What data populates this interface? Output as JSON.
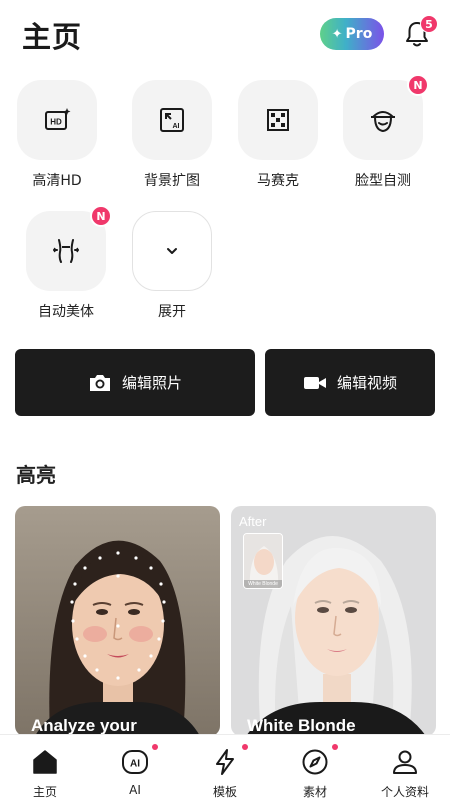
{
  "header": {
    "title": "主页",
    "pro_label": "Pro",
    "notification_count": "5"
  },
  "tools": [
    {
      "label": "高清HD",
      "icon": "hd-icon",
      "badge": ""
    },
    {
      "label": "背景扩图",
      "icon": "ai-expand-icon",
      "badge": ""
    },
    {
      "label": "马赛克",
      "icon": "mosaic-icon",
      "badge": ""
    },
    {
      "label": "脸型自测",
      "icon": "face-shape-icon",
      "badge": "N"
    },
    {
      "label": "自动美体",
      "icon": "body-reshape-icon",
      "badge": "N"
    },
    {
      "label": "展开",
      "icon": "chevron-down-icon",
      "badge": ""
    }
  ],
  "actions": {
    "edit_photo": "编辑照片",
    "edit_video": "编辑视频"
  },
  "highlights": {
    "title": "高亮",
    "cards": [
      {
        "title": "Analyze your"
      },
      {
        "title": "White Blonde",
        "after_label": "After",
        "thumb_label": "White Blonde"
      }
    ]
  },
  "tabbar": [
    {
      "label": "主页",
      "icon": "home-icon",
      "active": true,
      "dot": false
    },
    {
      "label": "AI",
      "icon": "ai-icon",
      "active": false,
      "dot": true
    },
    {
      "label": "模板",
      "icon": "lightning-icon",
      "active": false,
      "dot": true
    },
    {
      "label": "素材",
      "icon": "compass-icon",
      "active": false,
      "dot": true
    },
    {
      "label": "个人资料",
      "icon": "profile-icon",
      "active": false,
      "dot": false
    }
  ],
  "colors": {
    "accent_badge": "#f0386b",
    "dark_button": "#1c1c1c",
    "tile_bg": "#f3f3f3"
  }
}
